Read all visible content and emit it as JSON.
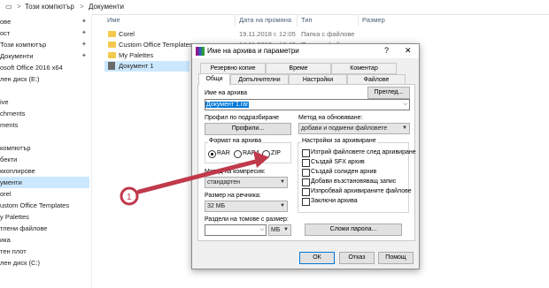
{
  "breadcrumb": {
    "part1": "Този компютър",
    "sep": ">",
    "part2": "Документи"
  },
  "sidebar": {
    "items": [
      {
        "label": "ове"
      },
      {
        "label": "ост"
      },
      {
        "label": "Този компютър"
      },
      {
        "label": "Документи"
      },
      {
        "label": "osoft Office 2016 x64"
      },
      {
        "label": "лен диск (E:)"
      },
      {
        "label": ""
      },
      {
        "label": "ive"
      },
      {
        "label": "chments"
      },
      {
        "label": "ments"
      },
      {
        "label": ""
      },
      {
        "label": "компютър"
      },
      {
        "label": "бекти"
      },
      {
        "label": "ккоплирове"
      },
      {
        "label": "ументи"
      },
      {
        "label": "orel"
      },
      {
        "label": "ustom Office Templates"
      },
      {
        "label": "y Palettes"
      },
      {
        "label": "тлени файлове"
      },
      {
        "label": "ика"
      },
      {
        "label": "тен плот"
      },
      {
        "label": "лен диск (C:)"
      }
    ]
  },
  "columns": {
    "name": "Име",
    "date": "Дата на промяна",
    "type": "Тип",
    "size": "Размер"
  },
  "files": [
    {
      "name": "Corel",
      "date": "19.11.2018 г. 12:05",
      "type": "Папка с файлове"
    },
    {
      "name": "Custom Office Templates",
      "date": "14.11.2018 г. 16:40",
      "type": "Папка с файлове"
    },
    {
      "name": "My Palettes",
      "date": "",
      "type": ""
    },
    {
      "name": "Документ 1",
      "date": "",
      "type": ""
    }
  ],
  "dialog": {
    "title": "Име на архива и параметри",
    "help": "?",
    "close": "✕",
    "tabs_row1": [
      "Резервно копие",
      "Време",
      "Коментар"
    ],
    "tabs_row2": [
      "Общи",
      "Допълнителни",
      "Настройки",
      "Файлове"
    ],
    "archive_name_label": "Име на архива",
    "browse_button": "Преглед...",
    "archive_name_value": "Документ 1.rar",
    "profile_label": "Профил по подразбиране",
    "profiles_button": "Профили...",
    "update_method_label": "Метод на обновяване:",
    "update_method_value": "добави и подмени файловете",
    "format_label": "Формат на архива",
    "format_options": [
      "RAR",
      "RAR4",
      "ZIP"
    ],
    "compression_label": "Метод на компресия:",
    "compression_value": "стандартен",
    "dictionary_label": "Размер на речника:",
    "dictionary_value": "32 МБ",
    "split_label": "Раздели на томове с размер:",
    "split_unit": "МБ",
    "archiving_options_label": "Настройки за архивиране",
    "archiving_options": [
      "Изтрий файловете след архивиране",
      "Създай SFX архив",
      "Създай солиден архив",
      "Добави възстановяващ запис",
      "Изпробвай архивираните файлове",
      "Заключи архива"
    ],
    "password_button": "Сложи парола...",
    "ok_button": "ОК",
    "cancel_button": "Отказ",
    "help_button": "Помощ"
  },
  "annotation": {
    "step": "1",
    "color": "#c0394b"
  }
}
